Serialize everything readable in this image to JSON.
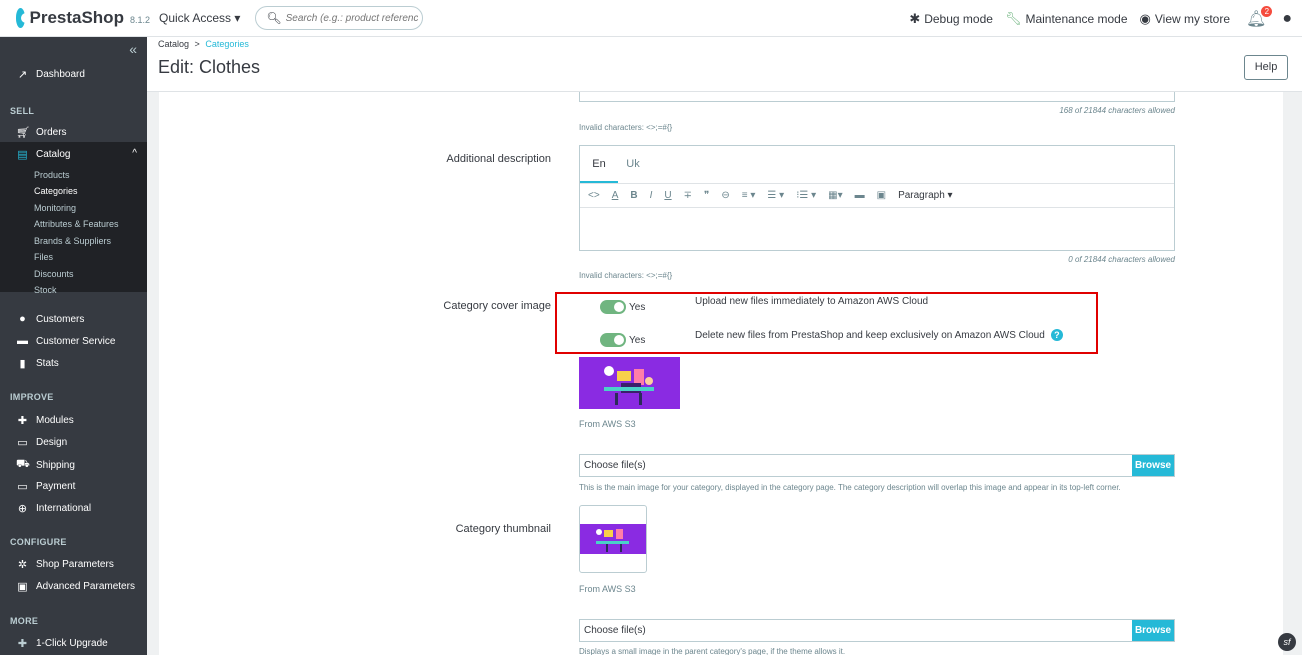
{
  "topbar": {
    "logo": "PrestaShop",
    "version": "8.1.2",
    "quick_access": "Quick Access ▾",
    "search_placeholder": "Search (e.g.: product reference, custon",
    "debug": "Debug mode",
    "maintenance": "Maintenance mode",
    "view_store": "View my store",
    "notifications": "2"
  },
  "sidebar": {
    "dashboard": "Dashboard",
    "sell": "SELL",
    "orders": "Orders",
    "catalog": "Catalog",
    "catalog_sub": [
      "Products",
      "Categories",
      "Monitoring",
      "Attributes & Features",
      "Brands & Suppliers",
      "Files",
      "Discounts",
      "Stock"
    ],
    "customers": "Customers",
    "customer_service": "Customer Service",
    "stats": "Stats",
    "improve": "IMPROVE",
    "modules": "Modules",
    "design": "Design",
    "shipping": "Shipping",
    "payment": "Payment",
    "international": "International",
    "configure": "CONFIGURE",
    "shop_parameters": "Shop Parameters",
    "advanced_parameters": "Advanced Parameters",
    "more": "MORE",
    "one_click": "1-Click Upgrade"
  },
  "header": {
    "breadcrumb_root": "Catalog",
    "breadcrumb_sep": ">",
    "breadcrumb_current": "Categories",
    "title": "Edit: Clothes",
    "help": "Help"
  },
  "form": {
    "desc_counter": "168 of 21844 characters allowed",
    "invalid_chars": "Invalid characters: <>;=#{}",
    "additional_label": "Additional description",
    "tab_en": "En",
    "tab_uk": "Uk",
    "toolbar": [
      "<>",
      "A",
      "B",
      "I",
      "U",
      "∓",
      "❞",
      "⊖",
      "≡ ▾",
      "☰ ▾",
      "⁝☰ ▾",
      "▦▾",
      "▬",
      "▣",
      "Paragraph ▾"
    ],
    "additional_counter": "0 of 21844 characters allowed",
    "invalid_chars2": "Invalid characters: <>;=#{}",
    "cover_label": "Category cover image",
    "toggle1_yes": "Yes",
    "toggle1_text": "Upload new files immediately to Amazon AWS Cloud",
    "toggle2_yes": "Yes",
    "toggle2_text": "Delete new files from PrestaShop and keep exclusively on Amazon AWS Cloud",
    "from_aws1": "From AWS S3",
    "file1_text": "Choose file(s)",
    "browse1": "Browse",
    "cover_help": "This is the main image for your category, displayed in the category page. The category description will overlap this image and appear in its top-left corner.",
    "thumb_label": "Category thumbnail",
    "from_aws2": "From AWS S3",
    "file2_text": "Choose file(s)",
    "browse2": "Browse",
    "thumb_help": "Displays a small image in the parent category's page, if the theme allows it."
  }
}
